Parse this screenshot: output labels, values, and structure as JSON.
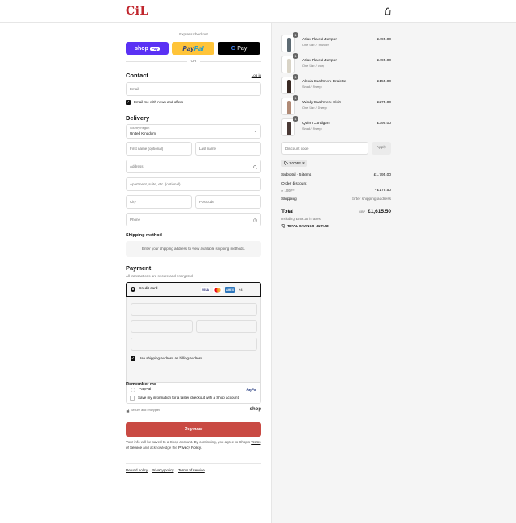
{
  "header": {
    "logo": "CiL",
    "cart_icon": "shopping-bag-icon"
  },
  "express": {
    "label": "Express checkout",
    "shop_pay": "shop",
    "shop_pay_tag": "Pay",
    "paypal_a": "Pay",
    "paypal_b": "Pal",
    "gpay_g": "G",
    "gpay_text": "Pay",
    "or": "OR"
  },
  "contact": {
    "title": "Contact",
    "login": "Log in",
    "email_placeholder": "Email",
    "newsletter_label": "Email me with news and offers",
    "newsletter_checked": true
  },
  "delivery": {
    "title": "Delivery",
    "country_label": "Country/Region",
    "country_value": "United Kingdom",
    "first_name": "First name (optional)",
    "last_name": "Last name",
    "address": "Address",
    "apartment": "Apartment, suite, etc. (optional)",
    "city": "City",
    "postcode": "Postcode",
    "phone": "Phone"
  },
  "shipping_method": {
    "title": "Shipping method",
    "message": "Enter your shipping address to view available shipping methods."
  },
  "payment": {
    "title": "Payment",
    "subtitle": "All transactions are secure and encrypted.",
    "credit_card": "Credit card",
    "card_logos": [
      "VISA",
      "MC",
      "AMEX"
    ],
    "more_cards": "+4",
    "billing_label": "Use shipping address as billing address",
    "billing_checked": true,
    "paypal_option": "PayPal",
    "paypal_logo": "PayPal",
    "brand_colors": {
      "visa": "#1a1f71",
      "mastercard": "#eb001b",
      "amex": "#2e77bc"
    }
  },
  "remember": {
    "title": "Remember me",
    "label": "Save my information for a faster checkout with a Shop account",
    "secure": "Secure and encrypted",
    "shop": "shop"
  },
  "pay_now": "Pay now",
  "legal": {
    "t1": "Your info will be saved to a Shop account. By continuing, you agree to Shop's",
    "terms": "Terms of Service",
    "t2": " and acknowledge the ",
    "privacy": "Privacy Policy",
    "t3": "."
  },
  "footer": [
    "Refund policy",
    "Privacy policy",
    "Terms of service"
  ],
  "summary": {
    "items": [
      {
        "name": "Atlas Flared Jumper",
        "variant": "One Size / Thunder",
        "price": "£495.00",
        "qty": "1",
        "color": "#5e6b73"
      },
      {
        "name": "Atlas Flared Jumper",
        "variant": "One Size / Ivory",
        "price": "£495.00",
        "qty": "1",
        "color": "#d9d4c7"
      },
      {
        "name": "Alexia Cashmere Bralette",
        "variant": "Small / Sheep",
        "price": "£155.00",
        "qty": "1",
        "color": "#3a2a24"
      },
      {
        "name": "Windy Cashmere Skirt",
        "variant": "One Size / Sheep",
        "price": "£275.00",
        "qty": "1",
        "color": "#b08a76"
      },
      {
        "name": "Quinn Cardigan",
        "variant": "Small / Sheep",
        "price": "£395.00",
        "qty": "1",
        "color": "#4a3a36"
      }
    ],
    "discount_placeholder": "Discount code",
    "apply": "Apply",
    "code_tag": "10OFF",
    "subtotal_label": "Subtotal · 5 items",
    "subtotal": "£1,795.00",
    "order_discount": "Order discount",
    "discount_code": "10OFF",
    "discount_amount": "- £179.50",
    "shipping_label": "Shipping",
    "shipping_value": "Enter shipping address",
    "total_label": "Total",
    "currency": "GBP",
    "total": "£1,615.50",
    "taxes": "Including £269.25 in taxes",
    "savings_label": "TOTAL SAVINGS",
    "savings": "£179.50"
  }
}
